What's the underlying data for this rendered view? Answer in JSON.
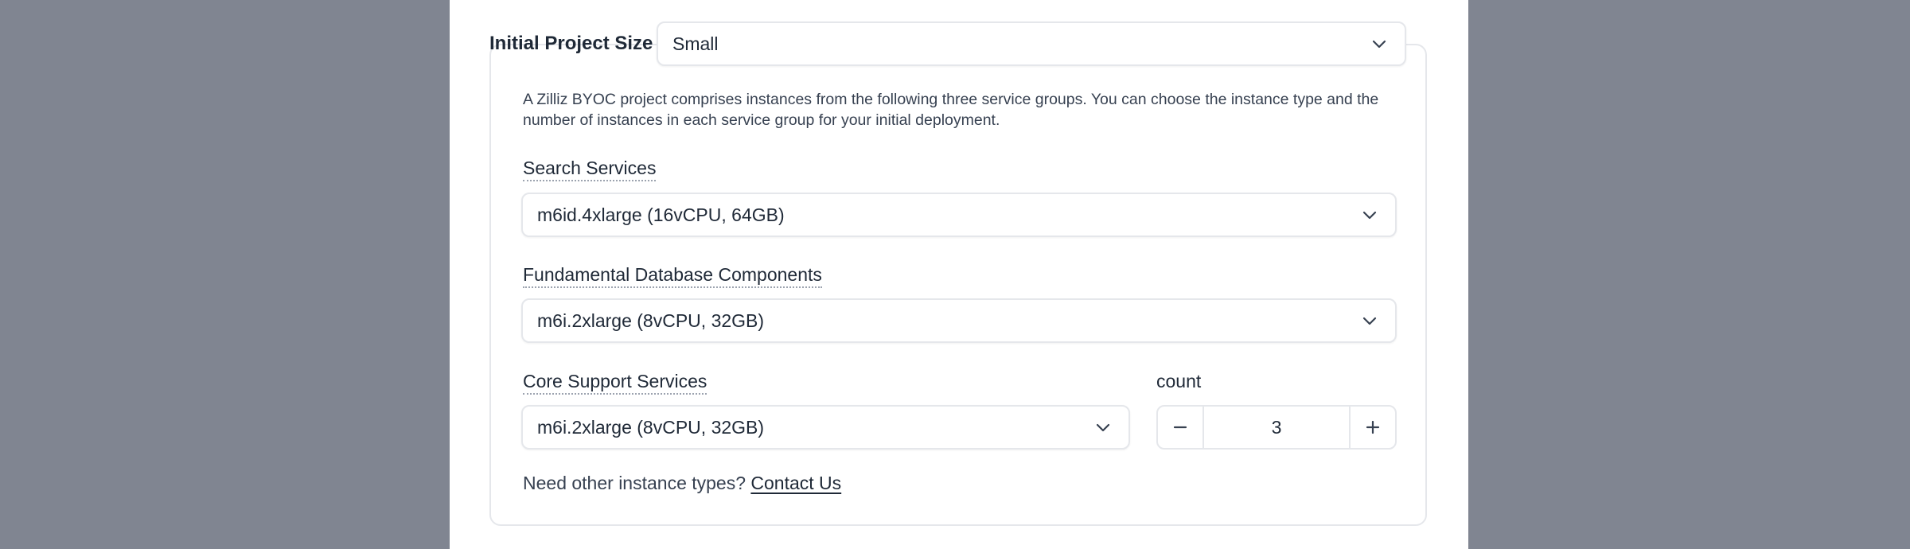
{
  "project_size": {
    "label": "Initial Project Size",
    "value": "Small"
  },
  "description": "A Zilliz BYOC project comprises instances from the following three service groups. You can choose the instance type and the number of instances in each service group for your initial deployment.",
  "groups": {
    "search": {
      "label": "Search Services",
      "value": "m6id.4xlarge (16vCPU, 64GB)"
    },
    "fundamental": {
      "label": "Fundamental Database Components",
      "value": "m6i.2xlarge (8vCPU, 32GB)"
    },
    "core": {
      "label": "Core Support Services",
      "value": "m6i.2xlarge (8vCPU, 32GB)"
    }
  },
  "count": {
    "label": "count",
    "value": "3"
  },
  "help": {
    "text": "Need other instance types?",
    "link": "Contact Us"
  },
  "icons": {
    "chevron": "chevron-down-icon",
    "minus": "minus-icon",
    "plus": "plus-icon"
  }
}
